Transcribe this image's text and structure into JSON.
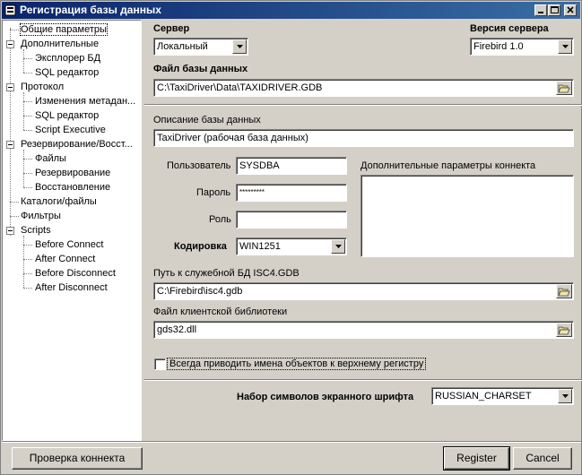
{
  "window": {
    "title": "Регистрация базы данных",
    "controls": {
      "minimize": "_",
      "maximize": "□",
      "close": "×"
    }
  },
  "tree": {
    "items": [
      {
        "label": "Общие параметры"
      },
      {
        "label": "Дополнительные"
      },
      {
        "label": "Эксплорер БД"
      },
      {
        "label": "SQL редактор"
      },
      {
        "label": "Протокол"
      },
      {
        "label": "Изменения метадан..."
      },
      {
        "label": "SQL редактор"
      },
      {
        "label": "Script Executive"
      },
      {
        "label": "Резервирование/Восст..."
      },
      {
        "label": "Файлы"
      },
      {
        "label": "Резервирование"
      },
      {
        "label": "Восстановление"
      },
      {
        "label": "Каталоги/файлы"
      },
      {
        "label": "Фильтры"
      },
      {
        "label": "Scripts"
      },
      {
        "label": "Before Connect"
      },
      {
        "label": "After Connect"
      },
      {
        "label": "Before Disconnect"
      },
      {
        "label": "After Disconnect"
      }
    ]
  },
  "server": {
    "label": "Сервер",
    "value": "Локальный"
  },
  "server_version": {
    "label": "Версия сервера",
    "value": "Firebird 1.0"
  },
  "db_file": {
    "label": "Файл базы данных",
    "value": "C:\\TaxiDriver\\Data\\TAXIDRIVER.GDB"
  },
  "description": {
    "label": "Описание базы данных",
    "value": "TaxiDriver (рабочая база данных)"
  },
  "user": {
    "label": "Пользователь",
    "value": "SYSDBA"
  },
  "password": {
    "label": "Пароль",
    "value": "*********"
  },
  "role": {
    "label": "Роль",
    "value": ""
  },
  "charset": {
    "label": "Кодировка",
    "value": "WIN1251"
  },
  "extra_params": {
    "label": "Дополнительные параметры коннекта"
  },
  "isc4_path": {
    "label": "Путь к служебной БД ISC4.GDB",
    "value": "C:\\Firebird\\isc4.gdb"
  },
  "client_lib": {
    "label": "Файл клиентской библиотеки",
    "value": "gds32.dll"
  },
  "uppercase": {
    "label": "Всегда приводить имена объектов к верхнему регистру",
    "checked": false
  },
  "screen_font_charset": {
    "label": "Набор символов экранного шрифта",
    "value": "RUSSIAN_CHARSET"
  },
  "buttons": {
    "test": "Проверка коннекта",
    "register": "Register",
    "cancel": "Cancel"
  },
  "colors": {
    "titlebar_start": "#0a246a",
    "titlebar_end": "#3a6ea5",
    "face": "#d4d0c8"
  }
}
